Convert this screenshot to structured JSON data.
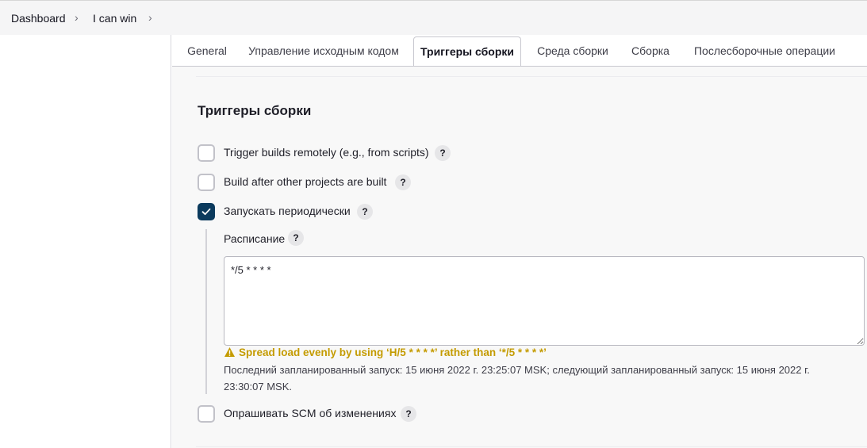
{
  "breadcrumb": {
    "items": [
      {
        "label": "Dashboard"
      },
      {
        "label": "I can win"
      }
    ],
    "separator": "›"
  },
  "tabs": [
    {
      "label": "General",
      "active": false
    },
    {
      "label": "Управление исходным кодом",
      "active": false
    },
    {
      "label": "Триггеры сборки",
      "active": true
    },
    {
      "label": "Среда сборки",
      "active": false
    },
    {
      "label": "Сборка",
      "active": false
    },
    {
      "label": "Послесборочные операции",
      "active": false
    }
  ],
  "section": {
    "title": "Триггеры сборки"
  },
  "triggers": [
    {
      "label": "Trigger builds remotely (e.g., from scripts)",
      "checked": false
    },
    {
      "label": "Build after other projects are built",
      "checked": false
    },
    {
      "label": "Запускать периодически",
      "checked": true
    },
    {
      "label": "Опрашивать SCM об изменениях",
      "checked": false
    }
  ],
  "schedule": {
    "label": "Расписание",
    "value": "*/5 * * * *",
    "warning": "Spread load evenly by using ‘H/5 * * * *’ rather than ‘*/5 * * * *’",
    "info": "Последний запланированный запуск: 15 июня 2022 г. 23:25:07 MSK; следующий запланированный запуск: 15 июня 2022 г. 23:30:07 MSK."
  },
  "help_label": "?",
  "colors": {
    "checkbox_checked": "#0b3a5d",
    "warning": "#c49b00",
    "accent_border": "#c8c8cf"
  }
}
